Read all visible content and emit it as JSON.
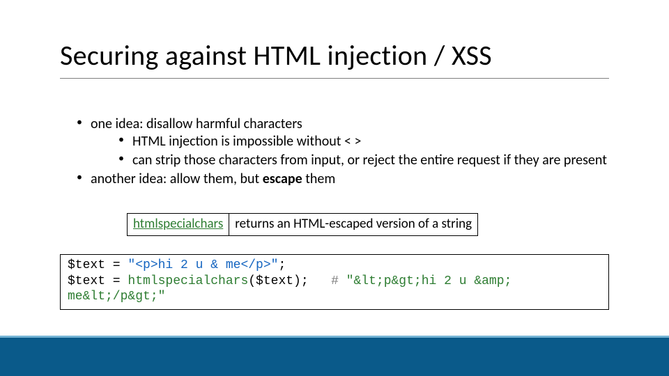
{
  "title": "Securing against HTML injection / XSS",
  "bullets": {
    "l1a": "one idea: disallow harmful characters",
    "l2a": "HTML injection is impossible without < >",
    "l2b": "can strip those characters from input, or reject the entire request if they are present",
    "l1b_pre": "another idea: allow them, but ",
    "l1b_bold": "escape",
    "l1b_post": " them"
  },
  "func_row": {
    "name": "htmlspecialchars",
    "desc": "returns an HTML-escaped version of a string"
  },
  "code": {
    "line1_a": "$text = ",
    "line1_str": "\"<p>hi 2 u & me</p>\"",
    "line1_b": ";",
    "line2_a": "$text = ",
    "line2_func": "htmlspecialchars",
    "line2_b": "($text);   ",
    "line2_hash": "# ",
    "line2_comment": "\"&lt;p&gt;hi 2 u &amp; me&lt;/p&gt;\""
  }
}
